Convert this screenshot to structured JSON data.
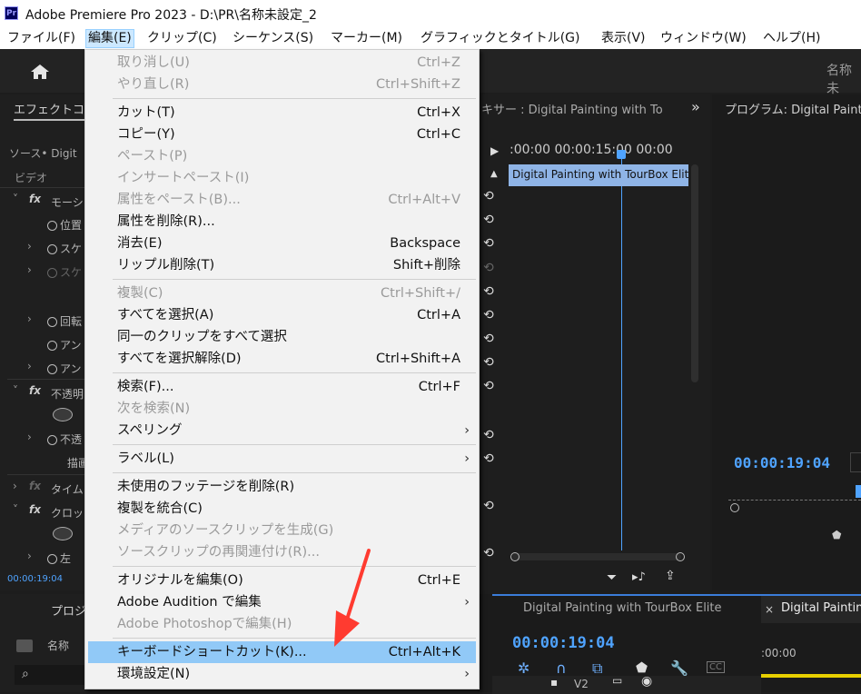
{
  "window": {
    "title": "Adobe Premiere Pro 2023 - D:\\PR\\名称未設定_2",
    "logo": "Pr"
  },
  "menubar": [
    {
      "label": "ファイル(F)"
    },
    {
      "label": "編集(E)"
    },
    {
      "label": "クリップ(C)"
    },
    {
      "label": "シーケンス(S)"
    },
    {
      "label": "マーカー(M)"
    },
    {
      "label": "グラフィックとタイトル(G)"
    },
    {
      "label": "表示(V)"
    },
    {
      "label": "ウィンドウ(W)"
    },
    {
      "label": "ヘルプ(H)"
    }
  ],
  "header": {
    "tail_name": "名称未",
    "home_icon": "home-icon"
  },
  "effects_panel": {
    "tab": "エフェクトコ",
    "source": "ソース• Digit",
    "video_label": "ビデオ",
    "rows": [
      "モーシ",
      "位置",
      "スケ",
      "スケ",
      "回転",
      "アン",
      "アン",
      "不透明",
      "不透",
      "描画",
      "タイム",
      "クロッ",
      "左"
    ],
    "timecode": "00:00:19:04"
  },
  "mixer_panel": {
    "title": "キサー : Digital Painting with To",
    "ruler": ":00:00   00:00:15:00   00:00",
    "clip": "Digital Painting with TourBox Elit"
  },
  "program_panel": {
    "title": "プログラム: Digital Painti",
    "timecode": "00:00:19:04"
  },
  "project_panel": {
    "tab": "プロジ",
    "name_col": "名称"
  },
  "timeline_panel": {
    "tab1": "Digital Painting with TourBox Elite",
    "tab2": "Digital Painting",
    "timecode": "00:00:19:04",
    "ruler": ":00:00",
    "track": "V2"
  },
  "edit_menu": {
    "items": [
      {
        "label": "取り消し(U)",
        "shortcut": "Ctrl+Z",
        "disabled": true
      },
      {
        "label": "やり直し(R)",
        "shortcut": "Ctrl+Shift+Z",
        "disabled": true
      },
      {
        "label": "カット(T)",
        "shortcut": "Ctrl+X"
      },
      {
        "label": "コピー(Y)",
        "shortcut": "Ctrl+C"
      },
      {
        "label": "ペースト(P)",
        "shortcut": "",
        "disabled": true
      },
      {
        "label": "インサートペースト(I)",
        "shortcut": "",
        "disabled": true
      },
      {
        "label": "属性をペースト(B)...",
        "shortcut": "Ctrl+Alt+V",
        "disabled": true
      },
      {
        "label": "属性を削除(R)...",
        "shortcut": ""
      },
      {
        "label": "消去(E)",
        "shortcut": "Backspace"
      },
      {
        "label": "リップル削除(T)",
        "shortcut": "Shift+削除"
      },
      {
        "label": "複製(C)",
        "shortcut": "Ctrl+Shift+/",
        "disabled": true
      },
      {
        "label": "すべてを選択(A)",
        "shortcut": "Ctrl+A"
      },
      {
        "label": "同一のクリップをすべて選択",
        "shortcut": ""
      },
      {
        "label": "すべてを選択解除(D)",
        "shortcut": "Ctrl+Shift+A"
      },
      {
        "label": "検索(F)...",
        "shortcut": "Ctrl+F"
      },
      {
        "label": "次を検索(N)",
        "shortcut": "",
        "disabled": true
      },
      {
        "label": "スペリング",
        "shortcut": "",
        "submenu": true
      },
      {
        "label": "ラベル(L)",
        "shortcut": "",
        "submenu": true
      },
      {
        "label": "未使用のフッテージを削除(R)",
        "shortcut": ""
      },
      {
        "label": "複製を統合(C)",
        "shortcut": ""
      },
      {
        "label": "メディアのソースクリップを生成(G)",
        "shortcut": "",
        "disabled": true
      },
      {
        "label": "ソースクリップの再関連付け(R)...",
        "shortcut": "",
        "disabled": true
      },
      {
        "label": "オリジナルを編集(O)",
        "shortcut": "Ctrl+E"
      },
      {
        "label": "Adobe Audition で編集",
        "shortcut": "",
        "submenu": true
      },
      {
        "label": "Adobe Photoshopで編集(H)",
        "shortcut": "",
        "disabled": true
      },
      {
        "label": "キーボードショートカット(K)...",
        "shortcut": "Ctrl+Alt+K",
        "highlighted": true
      },
      {
        "label": "環境設定(N)",
        "shortcut": "",
        "submenu": true
      }
    ],
    "submenu_arrow": "›"
  },
  "colors": {
    "accent": "#4fa3ff",
    "menu_highlight": "#91c9f7",
    "arrow": "#ff3b30",
    "clip": "#8fb4e6"
  }
}
